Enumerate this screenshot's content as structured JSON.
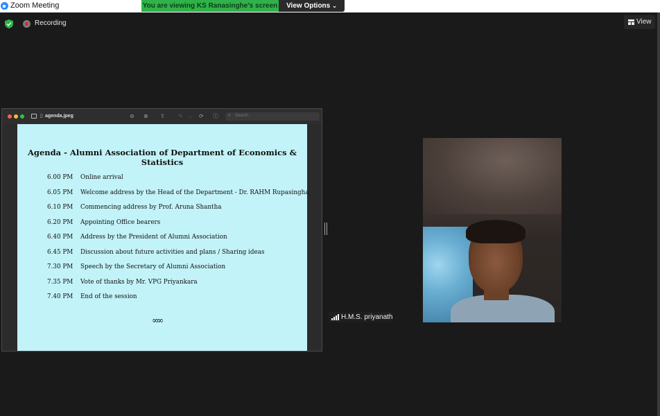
{
  "window": {
    "title": "Zoom Meeting"
  },
  "banner": {
    "viewing_text": "You are viewing KS Ranasinghe's screen",
    "view_options_label": "View Options"
  },
  "top_bar": {
    "recording_label": "Recording",
    "view_label": "View"
  },
  "shared_screen": {
    "viewer": {
      "filename": "agenda.jpeg",
      "search_placeholder": "Search"
    },
    "agenda": {
      "title": "Agenda - Alumni Association of Department of Economics & Statistics",
      "items": [
        {
          "time": "6.00 PM",
          "item": "Online arrival"
        },
        {
          "time": "6.05 PM",
          "item": "Welcome address by the Head of the Department - Dr. RAHM Rupasingha"
        },
        {
          "time": "6.10 PM",
          "item": "Commencing address by Prof. Aruna Shantha"
        },
        {
          "time": "6.20 PM",
          "item": "Appointing Office bearers"
        },
        {
          "time": "6.40 PM",
          "item": "Address by the President of Alumni Association"
        },
        {
          "time": "6.45 PM",
          "item": "Discussion about future activities and plans / Sharing ideas"
        },
        {
          "time": "7.30 PM",
          "item": "Speech by the Secretary of Alumni Association"
        },
        {
          "time": "7.35 PM",
          "item": "Vote of thanks by Mr. VPG Priyankara"
        },
        {
          "time": "7.40 PM",
          "item": "End of the session"
        }
      ],
      "flourish": "∞∞"
    }
  },
  "participant": {
    "name": "H.M.S. priyanath"
  },
  "colors": {
    "banner_green": "#2fb24a",
    "page_cyan": "#c2f3f8",
    "background": "#1a1a1a"
  },
  "icons": [
    "zoom-app-icon",
    "shield-check-icon",
    "recording-icon",
    "grid-view-icon",
    "chevron-down-icon",
    "sidebar-icon",
    "zoom-out-icon",
    "zoom-in-icon",
    "share-icon",
    "markup-icon",
    "rotate-icon",
    "info-icon",
    "search-icon",
    "signal-bars-icon"
  ]
}
